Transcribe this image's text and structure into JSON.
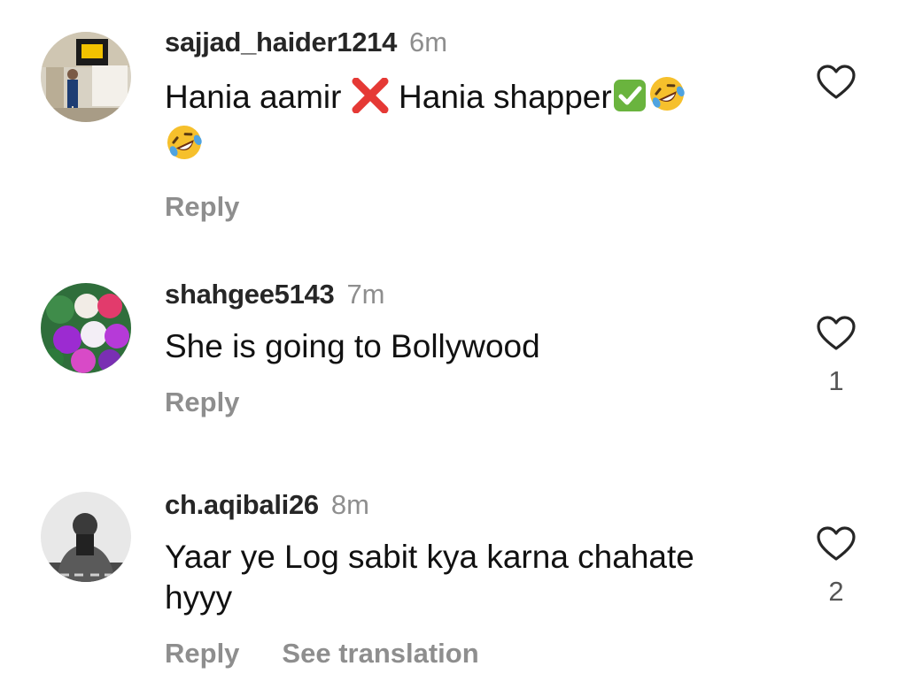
{
  "comments": [
    {
      "username": "sajjad_haider1214",
      "time": "6m",
      "text_part1": "Hania aamir ",
      "text_part2": " Hania shapper",
      "emojis": [
        "cross-mark",
        "check-mark-button",
        "rolling-on-floor-laughing",
        "rolling-on-floor-laughing"
      ],
      "reply_label": "Reply",
      "likes": ""
    },
    {
      "username": "shahgee5143",
      "time": "7m",
      "text": "She is going to Bollywood",
      "reply_label": "Reply",
      "likes": "1"
    },
    {
      "username": "ch.aqibali26",
      "time": "8m",
      "text": "Yaar ye Log sabit kya karna chahate hyyy",
      "reply_label": "Reply",
      "see_translation_label": "See translation",
      "likes": "2"
    }
  ],
  "colors": {
    "username": "#262626",
    "muted": "#8e8e8e",
    "text": "#111111",
    "cross": "#e53935",
    "check": "#6ab43e",
    "laugh": "#f6c02c"
  }
}
